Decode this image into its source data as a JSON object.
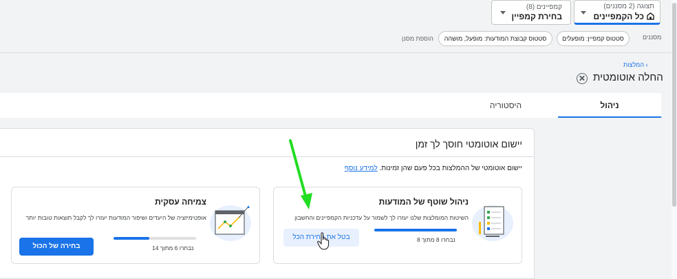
{
  "header": {
    "view_selector": {
      "small": "תצוגה (2 מסננים)",
      "value": "כל הקמפיינים"
    },
    "campaign_selector": {
      "small": "קמפיינים (8)",
      "value": "בחירת קמפיין"
    }
  },
  "filters": {
    "label": "מסננים",
    "chips": [
      "סטטוס קמפיין: מופעלים",
      "סטטוס קבוצת המודעות: מופעל, מושהה"
    ],
    "add_filter": "הוספת מסנן"
  },
  "breadcrumb": {
    "label": "המלצות"
  },
  "page_title": "החלה אוטומטית",
  "tabs": [
    {
      "label": "ניהול",
      "active": true
    },
    {
      "label": "היסטוריה",
      "active": false
    }
  ],
  "card": {
    "title": "יישום אוטומטי חוסך לך זמן",
    "description": "יישום אוטומטי של ההמלצות בכל פעם שהן זמינות.",
    "learn_more": "למידע נוסף",
    "items": [
      {
        "title": "ניהול שוטף של המודעות",
        "body": "השיטות המומלצות שלנו יעזרו לך לשמור על עדכניות הקמפיינים והחשבון",
        "progress_label": "נבחרו 8 מתוך 8",
        "progress": 1.0,
        "button": "בטל את בחירת הכל"
      },
      {
        "title": "צמיחה עסקית",
        "body": "אופטימיזציה של היעדים ושיפור המודעות יעזרו לך לקבל תוצאות טובות יותר",
        "progress_label": "נבחרו 6 מתוך 14",
        "progress": 0.43,
        "button": "בחירה של הכול"
      }
    ]
  },
  "colors": {
    "accent": "#1a73e8",
    "arrow": "#22dd22"
  }
}
